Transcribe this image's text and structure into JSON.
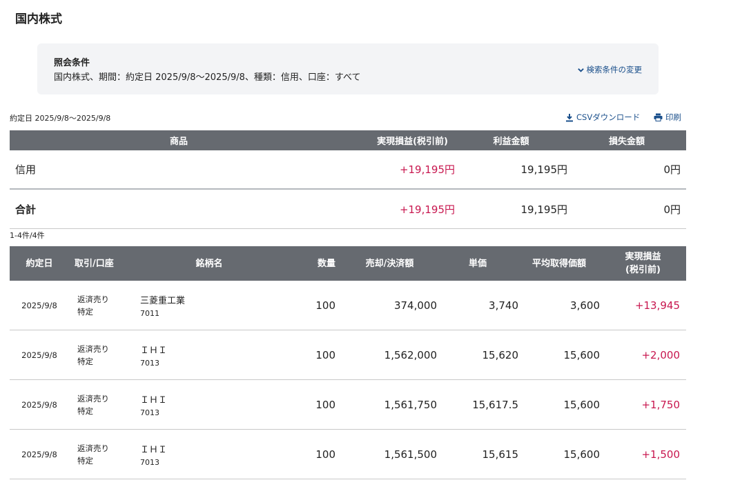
{
  "page": {
    "title": "国内株式"
  },
  "conditions": {
    "label": "照会条件",
    "text": "国内株式、期間：約定日 2025/9/8～2025/9/8、種類：信用、口座：すべて",
    "change_link": "検索条件の変更"
  },
  "period_text": "約定日 2025/9/8～2025/9/8",
  "actions": {
    "csv": "CSVダウンロード",
    "print": "印刷"
  },
  "summary": {
    "headers": [
      "商品",
      "実現損益(税引前)",
      "利益金額",
      "損失金額"
    ],
    "rows": [
      {
        "product": "信用",
        "realized": "+19,195円",
        "profit": "19,195円",
        "loss": "0円"
      }
    ],
    "total": {
      "label": "合計",
      "realized": "+19,195円",
      "profit": "19,195円",
      "loss": "0円"
    }
  },
  "result_count": "1-4件/4件",
  "detail": {
    "headers": {
      "date": "約定日",
      "trade": "取引/口座",
      "name": "銘柄名",
      "qty": "数量",
      "amount": "売却/決済額",
      "price": "単価",
      "avg": "平均取得価額",
      "realized_1": "実現損益",
      "realized_2": "(税引前)"
    },
    "rows": [
      {
        "date": "2025/9/8",
        "trade": "返済売り",
        "account": "特定",
        "name": "三菱重工業",
        "code": "7011",
        "qty": "100",
        "amount": "374,000",
        "price": "3,740",
        "avg": "3,600",
        "realized": "+13,945"
      },
      {
        "date": "2025/9/8",
        "trade": "返済売り",
        "account": "特定",
        "name": "ＩＨＩ",
        "code": "7013",
        "qty": "100",
        "amount": "1,562,000",
        "price": "15,620",
        "avg": "15,600",
        "realized": "+2,000"
      },
      {
        "date": "2025/9/8",
        "trade": "返済売り",
        "account": "特定",
        "name": "ＩＨＩ",
        "code": "7013",
        "qty": "100",
        "amount": "1,561,750",
        "price": "15,617.5",
        "avg": "15,600",
        "realized": "+1,750"
      },
      {
        "date": "2025/9/8",
        "trade": "返済売り",
        "account": "特定",
        "name": "ＩＨＩ",
        "code": "7013",
        "qty": "100",
        "amount": "1,561,500",
        "price": "15,615",
        "avg": "15,600",
        "realized": "+1,500"
      }
    ]
  },
  "colors": {
    "header_bg": "#666a70",
    "positive": "#c8174f",
    "link": "#1a4f8b",
    "panel_bg": "#f3f4f6"
  }
}
